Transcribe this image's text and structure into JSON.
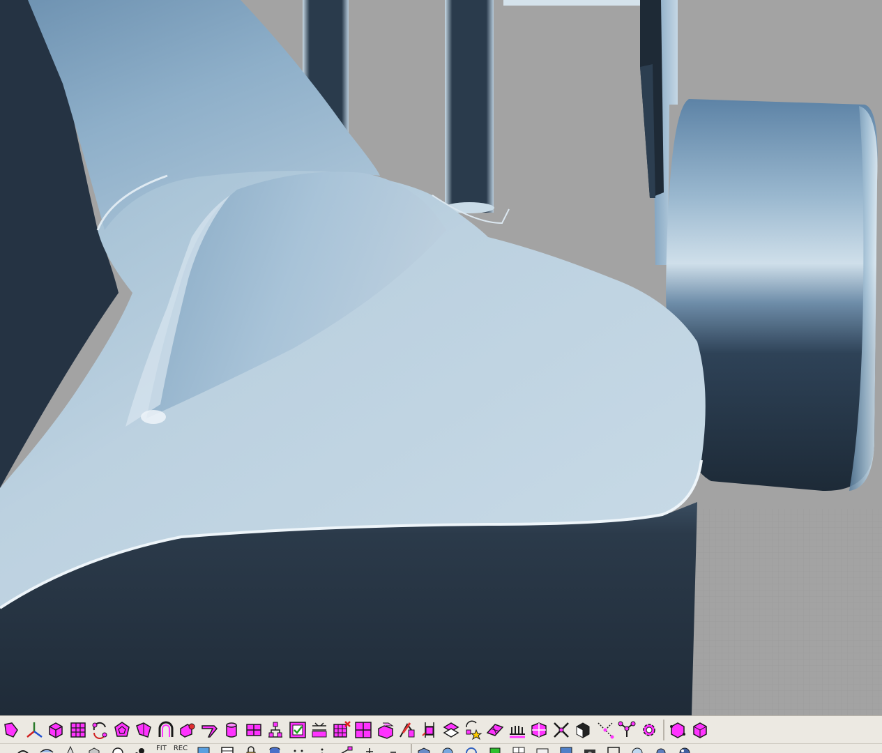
{
  "colors": {
    "background_gray": "#a3a3a3",
    "surface_light": "#c5d8e6",
    "surface_mid": "#8fb2cc",
    "surface_dark": "#233140",
    "toolbar_bg": "#ece9e2",
    "icon_magenta": "#ff33ff",
    "icon_outline": "#1a1a1a"
  },
  "toolbar_row_1": {
    "icons": [
      "curve-from-object-icon",
      "gumball-axes-icon",
      "box-solid-icon",
      "point-grid-icon",
      "rotate-points-icon",
      "polyhedron-icon",
      "unroll-surface-icon",
      "arch-curve-icon",
      "fillet-edge-icon",
      "extrude-curve-icon",
      "cylinder-solid-icon",
      "split-grid-icon",
      "array-points-icon",
      "check-box-icon",
      "distribute-icon",
      "delete-grid-icon",
      "grid-frame-icon",
      "layered-box-icon",
      "rebuild-edge-icon",
      "ladder-grid-icon",
      "flip-surface-icon",
      "star-transform-icon",
      "plane-surface-icon",
      "comb-icon",
      "mesh-box-icon",
      "cross-triangle-icon",
      "render-cube-icon",
      "point-split-icon",
      "branch-points-icon",
      "gear-icon",
      "box-vertices-icon",
      "box-edit-icon"
    ]
  },
  "toolbar_row_2": {
    "items": [
      {
        "icon": "sweep-icon"
      },
      {
        "icon": "surface-icon"
      },
      {
        "icon": "cone-icon"
      },
      {
        "icon": "cube-icon"
      },
      {
        "icon": "sphere-icon"
      },
      {
        "icon": "node-icon"
      },
      {
        "text": "FIT"
      },
      {
        "text": "REC"
      },
      {
        "icon": "frame-icon"
      },
      {
        "icon": "window-icon"
      },
      {
        "icon": "lock-icon"
      },
      {
        "icon": "cylinder-icon"
      },
      {
        "icon": "points-icon"
      },
      {
        "icon": "dots-icon"
      },
      {
        "icon": "align-icon"
      },
      {
        "icon": "plus-icon"
      },
      {
        "icon": "minus-icon"
      },
      {
        "icon": "box-icon"
      },
      {
        "icon": "render-icon"
      },
      {
        "icon": "rotate-icon"
      },
      {
        "icon": "color-icon"
      },
      {
        "icon": "grid-icon"
      },
      {
        "icon": "layer-icon"
      },
      {
        "icon": "shade-icon"
      },
      {
        "icon": "camera-icon"
      },
      {
        "icon": "wire-icon"
      },
      {
        "icon": "globe-icon"
      },
      {
        "icon": "light-icon"
      },
      {
        "icon": "ball-icon"
      }
    ]
  }
}
